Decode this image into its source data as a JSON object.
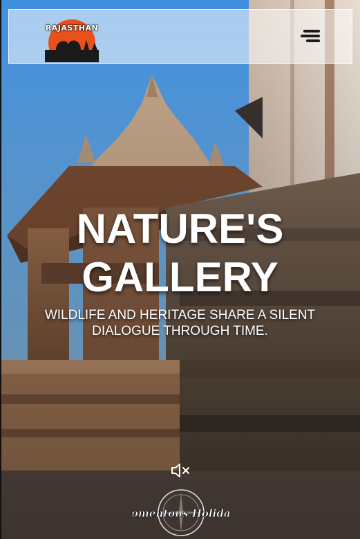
{
  "header": {
    "logo_text": "RAJASTHAN",
    "menu_icon": "hamburger-menu-icon"
  },
  "hero": {
    "title_line1": "NATURE'S",
    "title_line2": "GALLERY",
    "subtitle": "WILDLIFE AND HERITAGE SHARE A SILENT DIALOGUE THROUGH TIME."
  },
  "controls": {
    "mute_icon": "speaker-muted-icon"
  },
  "footer": {
    "logo_text": "Momentous Holidays"
  },
  "colors": {
    "sky": "#5aa7e6",
    "stone": "#8a6a4f",
    "logo_orange": "#e8501c"
  }
}
